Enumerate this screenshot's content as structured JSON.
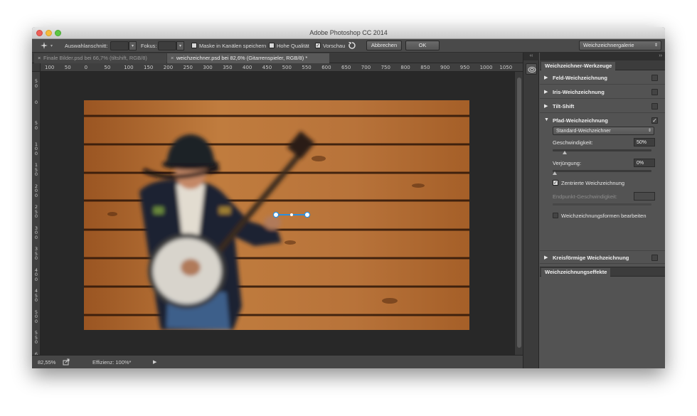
{
  "window": {
    "title": "Adobe Photoshop CC 2014"
  },
  "options_bar": {
    "selection_label": "Auswahlanschnitt:",
    "focus_label": "Fokus:",
    "save_mask_label": "Maske in Kanälen speichern",
    "save_mask_checked": false,
    "high_quality_label": "Hohe Qualität",
    "high_quality_checked": false,
    "preview_label": "Vorschau",
    "preview_checked": true,
    "cancel_label": "Abbrechen",
    "ok_label": "OK",
    "workspace_value": "Weichzeichnergalerie"
  },
  "tabs": [
    {
      "label": "Finale Bilder.psd bei 66,7% (tiltshift, RGB/8)",
      "active": false
    },
    {
      "label": "weichzeichner.psd bei 82,6% (Gitarrenspieler, RGB/8) *",
      "active": true
    }
  ],
  "ruler_h": [
    "100",
    "50",
    "0",
    "50",
    "100",
    "150",
    "200",
    "250",
    "300",
    "350",
    "400",
    "450",
    "500",
    "550",
    "600",
    "650",
    "700",
    "750",
    "800",
    "850",
    "900",
    "950",
    "1000",
    "1050"
  ],
  "ruler_v": [
    "50",
    "0",
    "50",
    "100",
    "150",
    "200",
    "250",
    "300",
    "350",
    "400",
    "450",
    "500",
    "550",
    "600"
  ],
  "status": {
    "zoom": "82,55%",
    "info": "Effizienz: 100%*"
  },
  "panel": {
    "dock_arrows": "‹‹",
    "panel_arrows": "››",
    "title": "Weichzeichner-Werkzeuge",
    "sections": [
      {
        "label": "Feld-Weichzeichnung",
        "checked": false
      },
      {
        "label": "Iris-Weichzeichnung",
        "checked": false
      },
      {
        "label": "Tilt-Shift",
        "checked": false
      },
      {
        "label": "Pfad-Weichzeichnung",
        "checked": true
      },
      {
        "label": "Kreisförmige Weichzeichnung",
        "checked": false
      }
    ],
    "path_blur": {
      "mode_value": "Standard-Weichzeichner",
      "speed_label": "Geschwindigkeit:",
      "speed_value": "50%",
      "speed": 0.12,
      "taper_label": "Verjüngung:",
      "taper_value": "0%",
      "taper": 0.0,
      "centered_label": "Zentrierte Weichzeichnung",
      "centered_checked": true,
      "endpoint_label": "Endpunkt-Geschwindigkeit:",
      "endpoint_value": "",
      "edit_shapes_label": "Weichzeichnungsformen bearbeiten",
      "edit_shapes_checked": false
    },
    "effects_title": "Weichzeichnungseffekte"
  },
  "colors": {
    "accent": "#1f8ad6",
    "wood": "#b06a2e",
    "canvas_bg": "#282828"
  }
}
